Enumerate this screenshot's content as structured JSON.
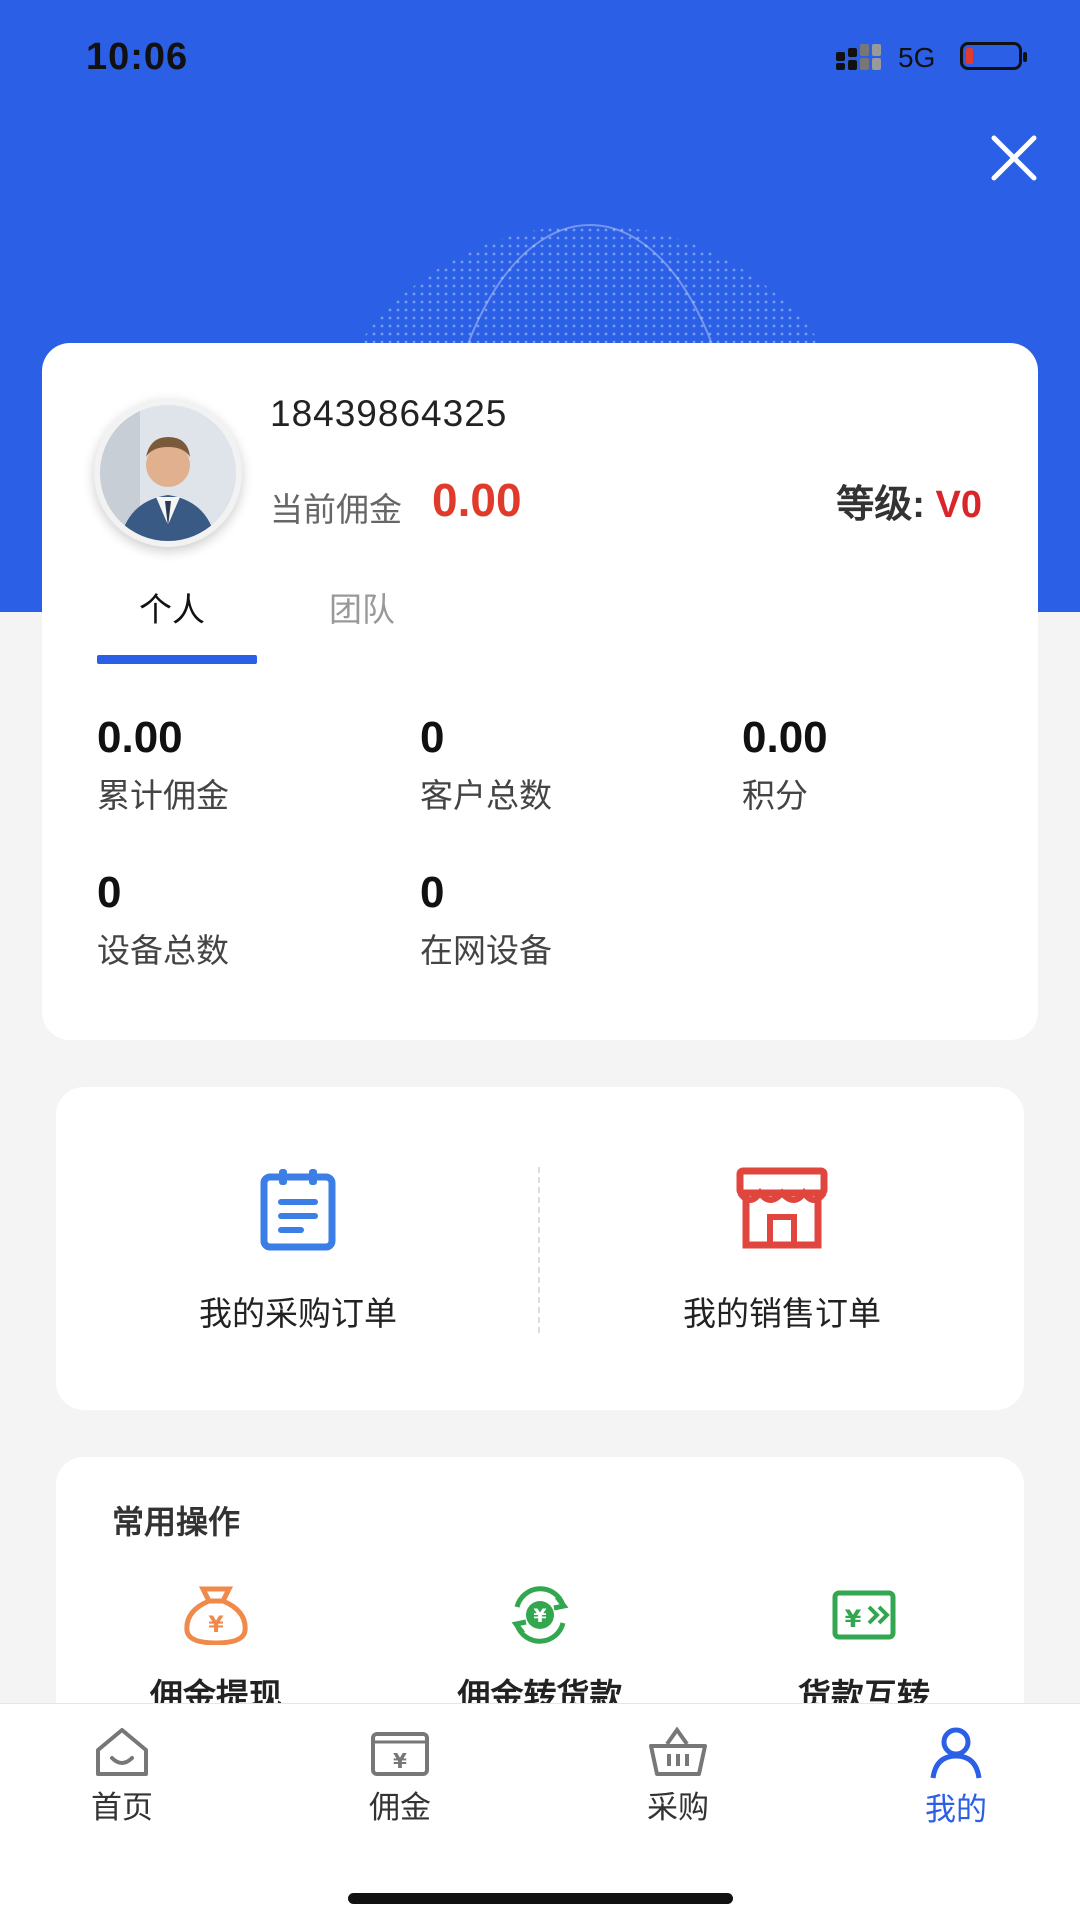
{
  "status_bar": {
    "time": "10:06",
    "network": "5G"
  },
  "profile": {
    "phone": "18439864325",
    "commission_label": "当前佣金",
    "commission_value": "0.00",
    "level_label": "等级:",
    "level_value": "V0"
  },
  "tabs": [
    {
      "label": "个人",
      "active": true
    },
    {
      "label": "团队",
      "active": false
    }
  ],
  "stats": [
    {
      "value": "0.00",
      "label": "累计佣金"
    },
    {
      "value": "0",
      "label": "客户总数"
    },
    {
      "value": "0.00",
      "label": "积分"
    },
    {
      "value": "0",
      "label": "设备总数"
    },
    {
      "value": "0",
      "label": "在网设备"
    }
  ],
  "orders": [
    {
      "label": "我的采购订单",
      "icon": "clipboard-icon",
      "color": "#3b7ee6"
    },
    {
      "label": "我的销售订单",
      "icon": "store-icon",
      "color": "#e0463d"
    }
  ],
  "ops": {
    "title": "常用操作",
    "items": [
      {
        "label": "佣金提现",
        "icon": "money-bag-icon",
        "color": "#ef8a4a"
      },
      {
        "label": "佣金转货款",
        "icon": "exchange-icon",
        "color": "#33a650"
      },
      {
        "label": "货款互转",
        "icon": "transfer-icon",
        "color": "#33a650"
      }
    ]
  },
  "tabbar": [
    {
      "label": "首页",
      "icon": "home-icon",
      "active": false
    },
    {
      "label": "佣金",
      "icon": "wallet-icon",
      "active": false
    },
    {
      "label": "采购",
      "icon": "basket-icon",
      "active": false
    },
    {
      "label": "我的",
      "icon": "person-icon",
      "active": true
    }
  ],
  "colors": {
    "primary": "#2a5fe6",
    "highlight_red": "#e03a2b"
  }
}
